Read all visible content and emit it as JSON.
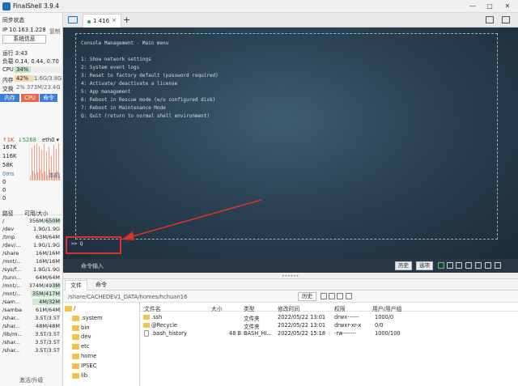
{
  "window": {
    "title": "FinalShell 3.9.4",
    "controls": [
      "—",
      "□",
      "✕"
    ]
  },
  "sidebar": {
    "sync_status": "同步状态",
    "ip": "IP 10.163.1.228",
    "copy": "复制",
    "sysinfo_button": "系统信息",
    "uptime": "运行 3:43",
    "load": "负载 0.14, 0.44, 0.70",
    "cpu": {
      "label": "CPU",
      "value": "34%",
      "percent": 34
    },
    "mem": {
      "label": "内存",
      "value": "42%",
      "detail": "1.6G/3.8G",
      "percent": 42
    },
    "swap": {
      "label": "交换",
      "value": "2%",
      "detail": "373M/23.4G",
      "percent": 2
    },
    "tabs": [
      "内存",
      "CPU",
      "命令"
    ],
    "net": {
      "up": "↑1K",
      "down": "↓5268",
      "iface": "eth0",
      "ticks": [
        "167K",
        "116K",
        "58K"
      ]
    },
    "latency": {
      "ms": "0ms",
      "local": "本机",
      "values": [
        "0",
        "0",
        "0"
      ]
    },
    "disk_header": {
      "path": "路径",
      "size": "可用/大小"
    },
    "disks": [
      {
        "path": "/",
        "value": "356M/650M",
        "fill": 0.45
      },
      {
        "path": "/dev",
        "value": "1.9G/1.9G",
        "fill": 0.0
      },
      {
        "path": "/tmp",
        "value": "63M/64M",
        "fill": 0.0
      },
      {
        "path": "/dev/...",
        "value": "1.9G/1.9G",
        "fill": 0.0
      },
      {
        "path": "/share",
        "value": "16M/16M",
        "fill": 0.0
      },
      {
        "path": "/mnt/...",
        "value": "16M/16M",
        "fill": 0.0
      },
      {
        "path": "/sys/f...",
        "value": "1.9G/1.9G",
        "fill": 0.0
      },
      {
        "path": "/tunn...",
        "value": "64M/64M",
        "fill": 0.0
      },
      {
        "path": "/mnt/...",
        "value": "374M/493M",
        "fill": 0.24
      },
      {
        "path": "/mnt/...",
        "value": "35M/417M",
        "fill": 0.92
      },
      {
        "path": "/sam...",
        "value": "4M/32M",
        "fill": 0.88
      },
      {
        "path": "/samba",
        "value": "61M/64M",
        "fill": 0.05
      },
      {
        "path": "/shar...",
        "value": "3.5T/3.5T",
        "fill": 0.0
      },
      {
        "path": "/shar...",
        "value": "48M/48M",
        "fill": 0.0
      },
      {
        "path": "/lib/m...",
        "value": "3.5T/3.5T",
        "fill": 0.0
      },
      {
        "path": "/shar...",
        "value": "3.5T/3.5T",
        "fill": 0.0
      },
      {
        "path": "/shar...",
        "value": "3.5T/3.5T",
        "fill": 0.0
      }
    ],
    "upgrade": "激活/升级"
  },
  "tabbar": {
    "tab_label": "1 416",
    "tab_close": "×",
    "add": "+"
  },
  "terminal": {
    "lines": [
      "Console Management - Main menu",
      "",
      "1: Show network settings",
      "2: System event logs",
      "3: Reset to factory default (password required)",
      "4: Activate/ deactivate a license",
      "5: App management",
      "6: Reboot in Rescue mode (w/o configured disk)",
      "7: Reboot in Maintenance Mode",
      "Q: Quit (return to normal shell environment)"
    ],
    "prompt": ">> Q"
  },
  "cmdbar": {
    "label": "命令输入",
    "history": "历史",
    "options": "选项"
  },
  "filepanel": {
    "tabs": [
      "文件",
      "命令"
    ],
    "path": "/share/CACHEDEV1_DATA/homes/hchuan16",
    "history": "历史",
    "tree": [
      "/",
      ".system",
      "bin",
      "dev",
      "etc",
      "home",
      "IPSEC",
      "lib"
    ],
    "columns": [
      "文件名",
      "大小",
      "类型",
      "修改时间",
      "权限",
      "用户/用户组"
    ],
    "files": [
      {
        "name": ".ssh",
        "size": "",
        "type": "文件夹",
        "mtime": "2022/05/22 13:01",
        "perm": "drwx------",
        "owner": "1000/0",
        "kind": "folder"
      },
      {
        "name": "@Recycle",
        "size": "",
        "type": "文件夹",
        "mtime": "2022/05/22 13:01",
        "perm": "drwxr-xr-x",
        "owner": "0/0",
        "kind": "folder"
      },
      {
        "name": ".bash_history",
        "size": "48 B",
        "type": "BASH_HI...",
        "mtime": "2022/05/22 15:18",
        "perm": "-rw-------",
        "owner": "1000/100",
        "kind": "file"
      }
    ]
  },
  "colors": {
    "accent": "#1d6fb8",
    "cpu_bar": "#bfe3c6",
    "tab_mem": "#3b7dd8",
    "tab_cpu": "#e26a4a",
    "tab_cmd": "#3b7dd8",
    "annotation": "#e0302a"
  }
}
